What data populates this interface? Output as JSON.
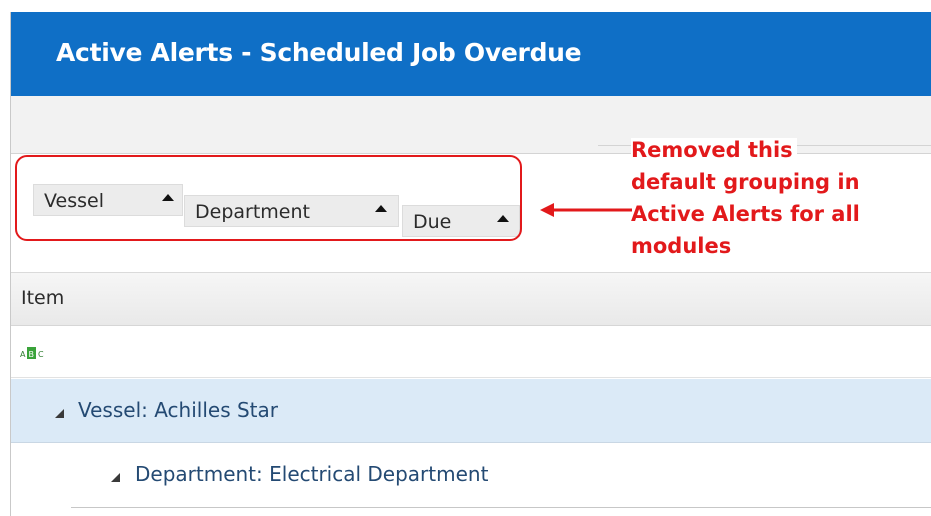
{
  "window": {
    "title": "Active Alerts - Scheduled Job Overdue"
  },
  "group_panel": {
    "chips": [
      {
        "label": "Vessel"
      },
      {
        "label": "Department"
      },
      {
        "label": "Due"
      }
    ]
  },
  "annotation": {
    "lines": [
      "Removed this",
      "default grouping in",
      "Active Alerts for all",
      "modules"
    ],
    "color": "#e2191b"
  },
  "grid": {
    "column_header": "Item",
    "filter_icon": "abc-text-filter-icon",
    "groups": {
      "vessel": "Vessel: Achilles Star",
      "department": "Department: Electrical Department"
    }
  },
  "colors": {
    "title_bar": "#0f6fc6",
    "group_row_highlight": "#dbeaf7",
    "group_text": "#244a73"
  }
}
